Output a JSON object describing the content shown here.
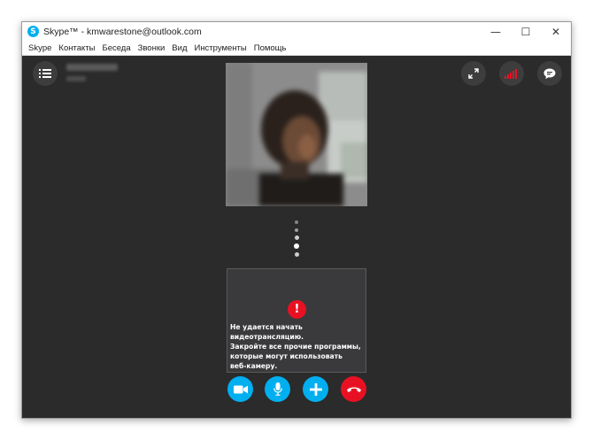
{
  "window": {
    "title": "Skype™ - kmwarestone@outlook.com",
    "app_icon_glyph": "S",
    "controls": {
      "minimize": "—",
      "maximize": "☐",
      "close": "✕"
    }
  },
  "menu": {
    "items": [
      "Skype",
      "Контакты",
      "Беседа",
      "Звонки",
      "Вид",
      "Инструменты",
      "Помощь"
    ]
  },
  "toolbar": {
    "left_icon": "list-icon",
    "right_icons": [
      "fullscreen-icon",
      "signal-icon",
      "chat-icon"
    ]
  },
  "call_status": {
    "error_icon_glyph": "!",
    "error_message": "Не удается начать видеотрансляцию.\nЗакройте все прочие программы,\nкоторые могут использовать\nвеб-камеру."
  },
  "controls": {
    "buttons": [
      "video-button",
      "mic-button",
      "add-button",
      "hangup-button"
    ],
    "colors": {
      "blue": "#00aff0",
      "red": "#e81123",
      "signal": "#e81123"
    }
  }
}
